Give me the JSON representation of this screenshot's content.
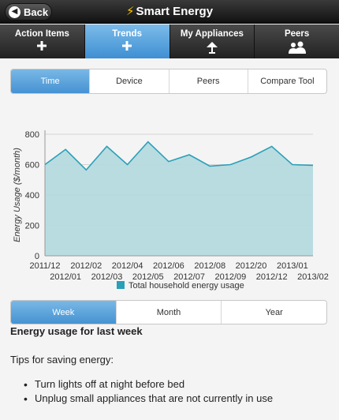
{
  "header": {
    "back_label": "Back",
    "title": "Smart Energy"
  },
  "nav": [
    {
      "label": "Action Items",
      "icon": "plus-icon",
      "active": false
    },
    {
      "label": "Trends",
      "icon": "plus-icon",
      "active": true
    },
    {
      "label": "My Appliances",
      "icon": "lamp-icon",
      "active": false
    },
    {
      "label": "Peers",
      "icon": "users-icon",
      "active": false
    }
  ],
  "view_tabs": [
    "Time",
    "Device",
    "Peers",
    "Compare Tool"
  ],
  "view_tabs_active": 0,
  "period_tabs": [
    "Week",
    "Month",
    "Year"
  ],
  "period_tabs_active": 0,
  "content": {
    "section_title": "Energy usage for last week",
    "tips_title": "Tips for saving energy:",
    "tips": [
      "Turn lights off at night before bed",
      "Unplug small appliances that are not currently in use"
    ]
  },
  "colors": {
    "accent": "#4592d2",
    "series_fill": "#b3d9de",
    "series_line": "#2a9fb8"
  },
  "chart_data": {
    "type": "area",
    "title": "",
    "xlabel": "",
    "ylabel": "Energy Usage ($/month)",
    "ylim": [
      0,
      800
    ],
    "yticks": [
      0,
      200,
      400,
      600,
      800
    ],
    "grid": true,
    "legend_position": "bottom",
    "x": [
      "2011/12",
      "2012/01",
      "2012/02",
      "2012/03",
      "2012/04",
      "2012/05",
      "2012/06",
      "2012/07",
      "2012/08",
      "2012/09",
      "2012/20",
      "2012/12",
      "2013/01",
      "2013/02"
    ],
    "series": [
      {
        "name": "Total household energy usage",
        "values": [
          600,
          700,
          565,
          720,
          600,
          750,
          620,
          665,
          590,
          600,
          650,
          720,
          600,
          595
        ]
      }
    ]
  }
}
